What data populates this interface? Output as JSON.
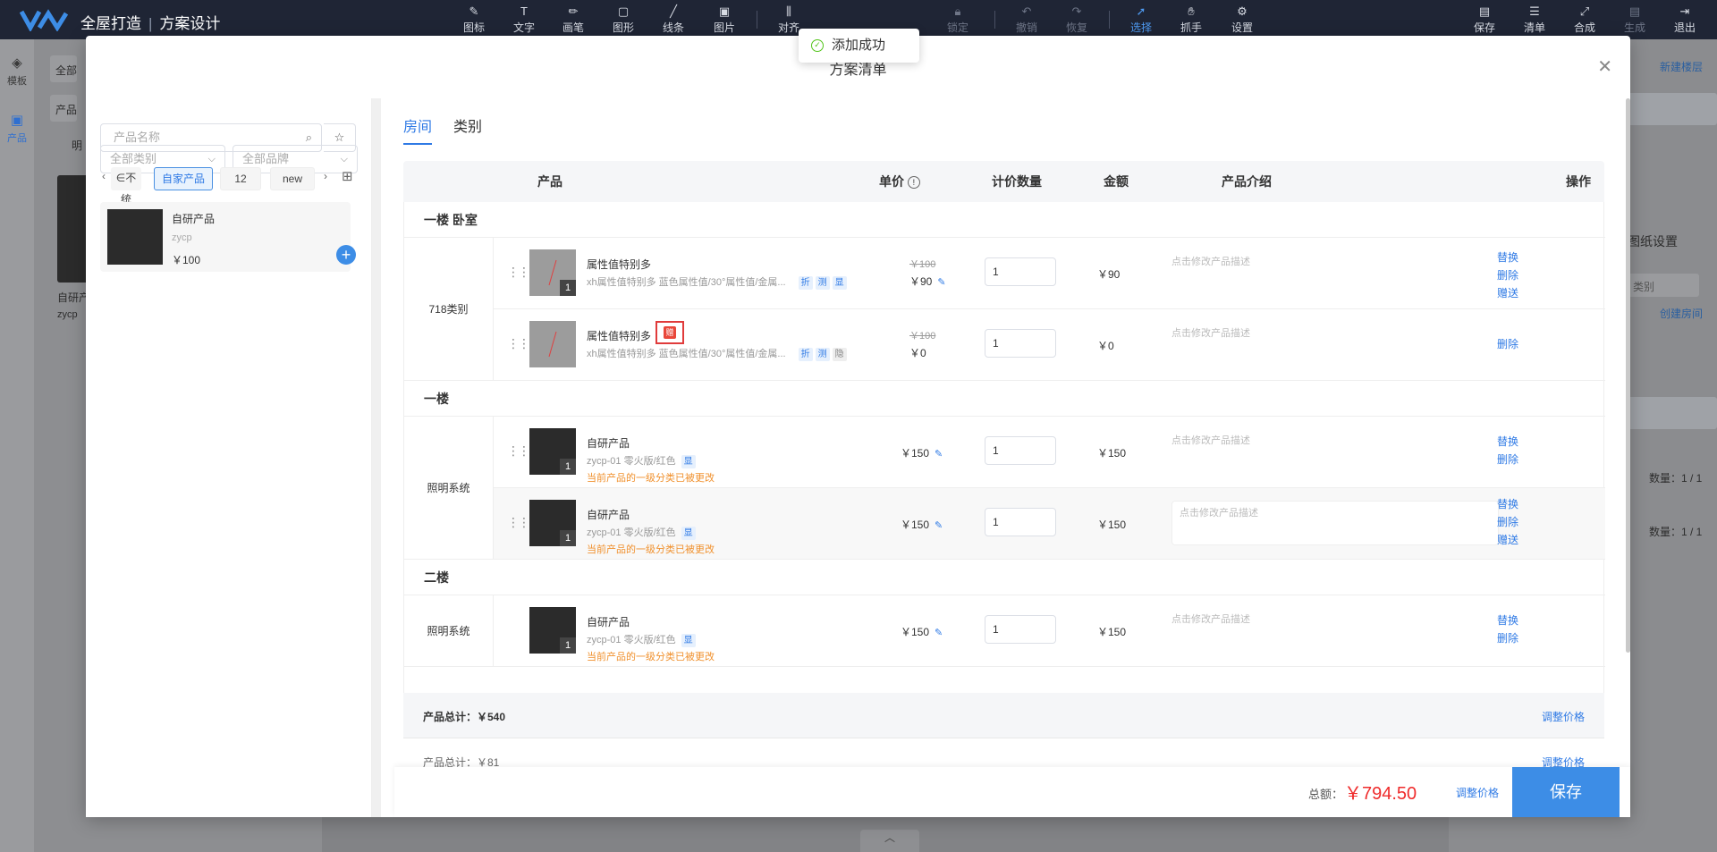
{
  "app": {
    "brand": "全屋打造",
    "subtitle": "方案设计"
  },
  "toolbar": [
    {
      "label": "图标",
      "icon": "✎",
      "state": "normal"
    },
    {
      "label": "文字",
      "icon": "T",
      "state": "normal"
    },
    {
      "label": "画笔",
      "icon": "✏",
      "state": "normal"
    },
    {
      "label": "图形",
      "icon": "▢",
      "state": "normal"
    },
    {
      "label": "线条",
      "icon": "╱",
      "state": "normal"
    },
    {
      "label": "图片",
      "icon": "▣",
      "state": "normal"
    },
    {
      "label": "对齐",
      "icon": "⫼",
      "state": "normal"
    },
    {
      "label": "锁定",
      "icon": "🔒︎",
      "state": "dim"
    },
    {
      "label": "撤销",
      "icon": "↶",
      "state": "dim"
    },
    {
      "label": "恢复",
      "icon": "↷",
      "state": "dim"
    },
    {
      "label": "选择",
      "icon": "➚",
      "state": "active"
    },
    {
      "label": "抓手",
      "icon": "✋︎",
      "state": "normal"
    },
    {
      "label": "设置",
      "icon": "⚙",
      "state": "normal"
    }
  ],
  "toolbar_right": [
    {
      "label": "保存",
      "icon": "▤",
      "state": "normal"
    },
    {
      "label": "清单",
      "icon": "☰",
      "state": "normal"
    },
    {
      "label": "合成",
      "icon": "⤢",
      "state": "normal"
    },
    {
      "label": "生成",
      "icon": "▤",
      "state": "dim"
    },
    {
      "label": "退出",
      "icon": "⇥",
      "state": "normal"
    }
  ],
  "rail": {
    "templates": "模板",
    "products": "产品"
  },
  "background": {
    "new_floor": "新建楼层",
    "drawing_settings": "图纸设置",
    "category": "类别",
    "create_room": "创建房间",
    "count1": "数量：1 / 1",
    "count2": "数量：1 / 1",
    "bg_item_name": "自研产",
    "bg_item_sub": "zycp",
    "bg_tab": "明",
    "bg_search1": "全部",
    "bg_search2": "产品"
  },
  "toast": {
    "text": "添加成功"
  },
  "modal": {
    "title": "方案清单",
    "left": {
      "category_select": "全部类别",
      "brand_select": "全部品牌",
      "search_placeholder": "产品名称",
      "chips": [
        "∈不统",
        "自家产品",
        "12",
        "new"
      ],
      "product": {
        "name": "自研产品",
        "code": "zycp",
        "price": "￥100"
      }
    },
    "tabs": [
      "房间",
      "类别"
    ],
    "headers": {
      "product": "产品",
      "price": "单价",
      "qty": "计价数量",
      "amount": "金额",
      "intro": "产品介绍",
      "ops": "操作"
    },
    "groups": [
      {
        "title": "一楼 卧室",
        "category": "718类别"
      },
      {
        "title": "一楼",
        "category": "照明系统"
      },
      {
        "title": "二楼",
        "category": "照明系统"
      }
    ],
    "rows": [
      {
        "name": "属性值特别多",
        "desc": "xh属性值特别多 蓝色属性值/30°属性值/金属...",
        "tags": [
          "折",
          "测",
          "显"
        ],
        "orig_price": "￥100",
        "price": "￥90",
        "qty": "1",
        "amount": "￥90",
        "intro": "点击修改产品描述",
        "ops": [
          "替换",
          "删除",
          "赠送"
        ],
        "badge": "1"
      },
      {
        "name": "属性值特别多",
        "desc": "xh属性值特别多 蓝色属性值/30°属性值/金属...",
        "tags": [
          "折",
          "测",
          "隐"
        ],
        "mark": "赠",
        "orig_price": "￥100",
        "price": "￥0",
        "qty": "1",
        "amount": "￥0",
        "intro": "点击修改产品描述",
        "ops": [
          "删除"
        ]
      },
      {
        "name": "自研产品",
        "desc": "zycp-01 零火版/红色",
        "tags": [
          "显"
        ],
        "warn": "当前产品的一级分类已被更改",
        "price": "￥150",
        "qty": "1",
        "amount": "￥150",
        "intro": "点击修改产品描述",
        "ops": [
          "替换",
          "删除"
        ],
        "badge": "1"
      },
      {
        "name": "自研产品",
        "desc": "zycp-01 零火版/红色",
        "tags": [
          "显"
        ],
        "warn": "当前产品的一级分类已被更改",
        "price": "￥150",
        "qty": "1",
        "amount": "￥150",
        "intro": "点击修改产品描述",
        "ops": [
          "替换",
          "删除",
          "赠送"
        ],
        "badge": "1"
      },
      {
        "name": "自研产品",
        "desc": "zycp-01 零火版/红色",
        "tags": [
          "显"
        ],
        "warn": "当前产品的一级分类已被更改",
        "price": "￥150",
        "qty": "1",
        "amount": "￥150",
        "intro": "点击修改产品描述",
        "ops": [
          "替换",
          "删除"
        ],
        "badge": "1"
      }
    ],
    "summary": [
      {
        "label": "产品总计：￥540",
        "link": "调整价格"
      },
      {
        "label": "产品总计：￥81",
        "link": "调整价格"
      }
    ],
    "footer": {
      "total_label": "总额：",
      "total_value": "￥794.50",
      "adjust": "调整价格",
      "save": "保存"
    }
  },
  "colors": {
    "accent": "#2f7ae5",
    "topbar": "#1f2535",
    "warn": "#f0912e",
    "total": "#ef2b2b"
  }
}
